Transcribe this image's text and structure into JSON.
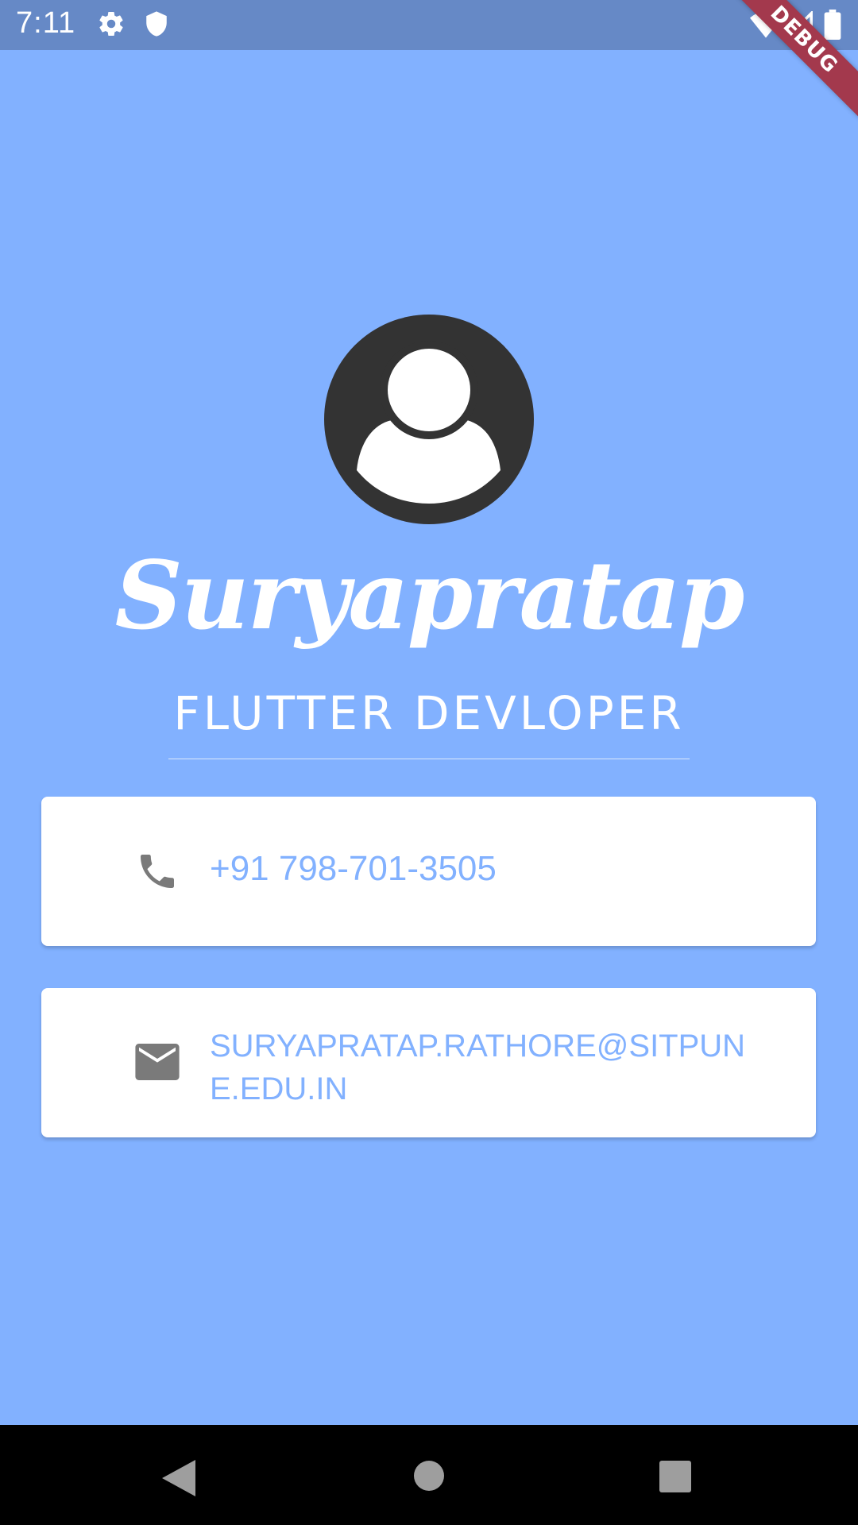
{
  "status_bar": {
    "time": "7:11",
    "icons": [
      "settings-icon",
      "shield-icon",
      "wifi-icon",
      "signal-icon",
      "battery-icon"
    ]
  },
  "debug_banner": {
    "label": "DEBUG",
    "color": "#a3394d"
  },
  "profile": {
    "avatar_icon": "account-circle-icon",
    "name": "Suryapratap",
    "role": "FLUTTER DEVLOPER"
  },
  "cards": {
    "phone": {
      "icon": "phone-icon",
      "value": "+91 798-701-3505"
    },
    "email": {
      "icon": "email-icon",
      "value": "SURYAPRATAP.RATHORE@SITPUNE.EDU.IN"
    }
  },
  "nav_bar": {
    "buttons": [
      "back-icon",
      "home-icon",
      "recents-icon"
    ]
  },
  "colors": {
    "background": "#82b1ff",
    "status_bar": "#6689c6",
    "card": "#ffffff",
    "card_text": "#82b1ff",
    "icon": "#7a7a7a",
    "avatar": "#333333"
  }
}
